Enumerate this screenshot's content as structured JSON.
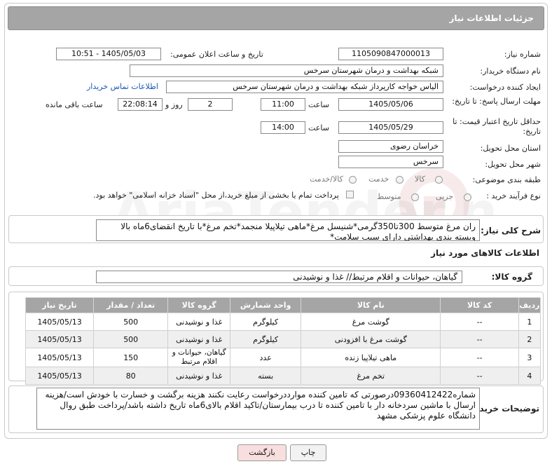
{
  "header": {
    "title": "جزئیات اطلاعات نیاز"
  },
  "fields": {
    "need_number_label": "شماره نیاز:",
    "need_number": "1105090847000013",
    "announce_label": "تاریخ و ساعت اعلان عمومی:",
    "announce_value": "1405/05/03 - 10:51",
    "buyer_org_label": "نام دستگاه خریدار:",
    "buyer_org": "شبکه بهداشت و درمان شهرستان سرخس",
    "creator_label": "ایجاد کننده درخواست:",
    "creator": "الیاس خواجه کارپرداز شبکه بهداشت و درمان شهرستان سرخس",
    "contact_link": "اطلاعات تماس خریدار",
    "deadline_label": "مهلت ارسال پاسخ: تا تاریخ:",
    "deadline_date": "1405/05/06",
    "time_label": "ساعت",
    "deadline_time": "11:00",
    "days_value": "2",
    "days_label": "روز و",
    "remaining_time": "22:08:14",
    "remaining_label": "ساعت باقی مانده",
    "validity_label": "حداقل تاریخ اعتبار قیمت: تا تاریخ:",
    "validity_date": "1405/05/29",
    "validity_time": "14:00",
    "province_label": "استان محل تحویل:",
    "province": "خراسان رضوی",
    "city_label": "شهر محل تحویل:",
    "city": "سرخس",
    "category_label": "طبقه بندی موضوعی:",
    "category_options": [
      "کالا",
      "خدمت",
      "کالا/خدمت"
    ],
    "process_label": "نوع فرآیند خرید :",
    "process_options": [
      "جزیی",
      "متوسط"
    ],
    "payment_note": "پرداخت تمام یا بخشی از مبلغ خرید،از محل \"اسناد خزانه اسلامی\" خواهد بود."
  },
  "summary": {
    "label": "شرح کلی نیاز:",
    "text": "ران مرغ متوسط 300تا350گرمی*شنیسل مرغ*ماهی تیلاپیلا منجمد*تخم مرغ*با تاریخ انقضای6ماه بالا وبسته بندی بهداشتی دارای سیب سلامت*"
  },
  "goods": {
    "section_title": "اطلاعات کالاهای مورد نیاز",
    "group_label": "گروه کالا:",
    "group_value": "گیاهان، حیوانات و اقلام مرتبط// غذا و نوشیدنی",
    "columns": [
      "ردیف",
      "کد کالا",
      "نام کالا",
      "واحد شمارش",
      "گروه کالا",
      "تعداد / مقدار",
      "تاریخ نیاز"
    ],
    "rows": [
      [
        "1",
        "--",
        "گوشت مرغ",
        "کیلوگرم",
        "غذا و نوشیدنی",
        "500",
        "1405/05/13"
      ],
      [
        "2",
        "--",
        "گوشت مرغ با افزودنی",
        "کیلوگرم",
        "غذا و نوشیدنی",
        "500",
        "1405/05/13"
      ],
      [
        "3",
        "--",
        "ماهی تیلاپیا زنده",
        "عدد",
        "گیاهان، حیوانات و اقلام مرتبط",
        "150",
        "1405/05/13"
      ],
      [
        "4",
        "--",
        "تخم مرغ",
        "بسته",
        "غذا و نوشیدنی",
        "80",
        "1405/05/13"
      ]
    ]
  },
  "buyer_notes": {
    "label": "توضیحات خریدار:",
    "text": "شماره09360412422درصورتی که تامین کننده موارددرخواست رعایت نکنند هزینه برگشت و خسارت با خودش است/هزینه ارسال با ماشین سردخانه دار با تامین کننده تا درب بیمارستان/تاکید اقلام بالای6ماه تاریخ داشته باشد/پرداخت طبق روال دانشگاه علوم پزشکی مشهد"
  },
  "buttons": {
    "print": "چاپ",
    "back": "بازگشت"
  },
  "colors": {
    "header_bg": "#a5a5a5",
    "link": "#1d57b8",
    "back_button_bg": "#f8dede"
  }
}
